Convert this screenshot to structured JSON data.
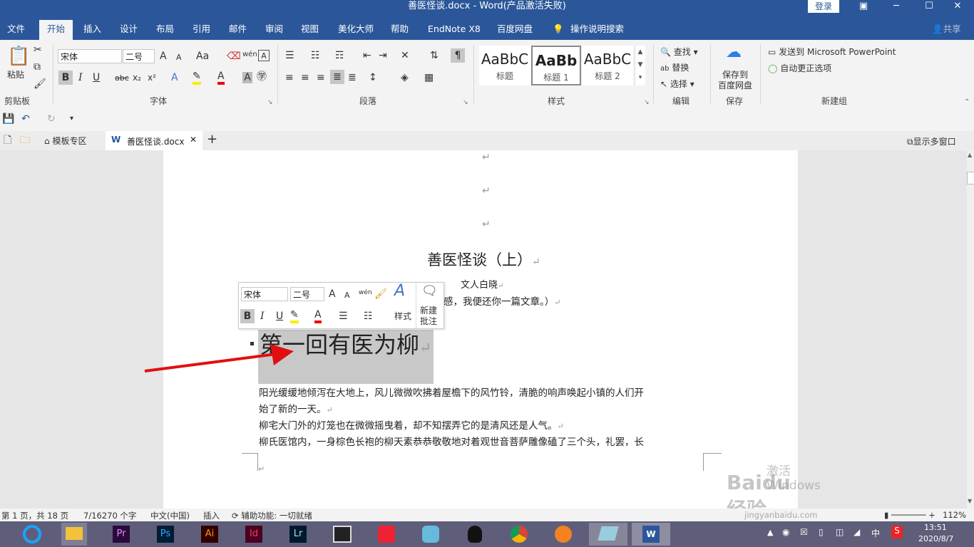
{
  "window": {
    "title": "善医怪谈.docx  -  Word(产品激活失败)",
    "login_label": "登录",
    "controls": {
      "ribbon_toggle": "▣",
      "minimize": "─",
      "maximize": "☐",
      "close": "✕"
    }
  },
  "tabs": {
    "file": "文件",
    "home": "开始",
    "insert": "插入",
    "design": "设计",
    "layout": "布局",
    "references": "引用",
    "mailings": "邮件",
    "review": "审阅",
    "view": "视图",
    "beautify": "美化大师",
    "help": "帮助",
    "endnote": "EndNote X8",
    "baidu": "百度网盘",
    "tell_me": "操作说明搜索",
    "share": "共享"
  },
  "ribbon": {
    "clipboard": {
      "label": "剪贴板",
      "paste": "粘贴"
    },
    "font": {
      "label": "字体",
      "font_name": "宋体",
      "font_size": "二号",
      "grow": "A",
      "shrink": "A",
      "case": "Aa",
      "wen": "wén",
      "bold": "B",
      "italic": "I",
      "underline": "U",
      "strike": "abc",
      "sub": "x₂",
      "sup": "x²"
    },
    "paragraph": {
      "label": "段落"
    },
    "styles": {
      "label": "样式",
      "items": [
        {
          "preview": "AaBbC",
          "name": "标题"
        },
        {
          "preview": "AaBb",
          "name": "标题 1"
        },
        {
          "preview": "AaBbC",
          "name": "标题 2"
        }
      ]
    },
    "editing": {
      "label": "编辑",
      "find": "查找",
      "replace": "替换",
      "select": "选择"
    },
    "save": {
      "label": "保存",
      "button": "保存到",
      "button2": "百度网盘"
    },
    "newgroup": {
      "label": "新建组",
      "send_ppt": "发送到 Microsoft PowerPoint",
      "autocorrect": "自动更正选项"
    }
  },
  "doctabs": {
    "templates": "模板专区",
    "current": "善医怪谈.docx",
    "add": "+",
    "multiwindow": "显示多窗口"
  },
  "document": {
    "title": "善医怪谈（上）",
    "author": "文人白晓",
    "preface": "感，我便还你一篇文章。）",
    "chapter": "第一回有医为柳",
    "para1_line1": "阳光缓缓地倾泻在大地上，风儿微微吹拂着屋檐下的风竹铃，清脆的响声唤起小镇的人们开",
    "para1_line2": "始了新的一天。",
    "para2": "柳宅大门外的灯笼也在微微摇曳着，却不知摆弄它的是清风还是人气。",
    "para3": "柳氏医馆内，一身棕色长袍的柳天素恭恭敬敬地对着观世音菩萨雕像磕了三个头，礼罢，长",
    "return_mark": "↵"
  },
  "mini_toolbar": {
    "font_name": "宋体",
    "font_size": "二号",
    "style_label": "样式",
    "new_comment": "新建",
    "new_comment2": "批注"
  },
  "status": {
    "page": "第 1 页，共 18 页",
    "words": "7/16270 个字",
    "language": "中文(中国)",
    "mode": "插入",
    "accessibility": "辅助功能: 一切就绪",
    "zoom": "112%"
  },
  "watermark": {
    "activate": "激活 Windows",
    "site": "jingyanbaidu.com",
    "brand": "Baidu经验"
  },
  "taskbar": {
    "apps": [
      "browser",
      "file-explorer",
      "premiere",
      "photoshop",
      "illustrator",
      "indesign",
      "lightroom",
      "video",
      "app-8",
      "app-9",
      "qq",
      "chrome",
      "app-12",
      "app-13",
      "word"
    ],
    "pr": "Pr",
    "ps": "Ps",
    "ai": "Ai",
    "id": "Id",
    "lr": "Lr",
    "tray_lang": "中",
    "time": "13:51",
    "date": "2020/8/7"
  }
}
